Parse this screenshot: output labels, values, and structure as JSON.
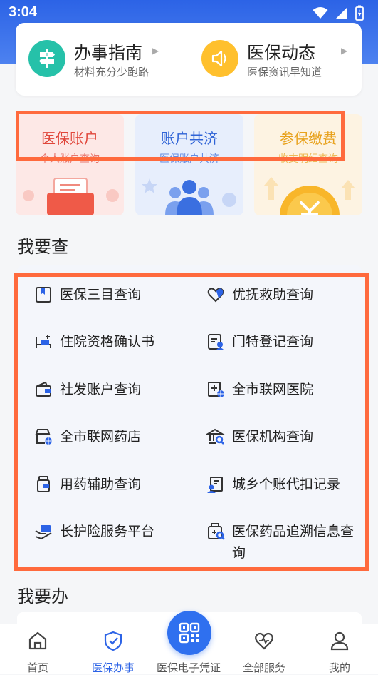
{
  "status": {
    "time": "3:04"
  },
  "guide": {
    "left": {
      "title": "办事指南",
      "subtitle": "材料充分少跑路",
      "icon": "signpost-icon"
    },
    "right": {
      "title": "医保动态",
      "subtitle": "医保资讯早知道",
      "icon": "speaker-icon"
    }
  },
  "tiles": [
    {
      "title": "医保账户",
      "subtitle": "个人账户查询",
      "color": "#e0463a",
      "bg": "#fde8e6"
    },
    {
      "title": "账户共济",
      "subtitle": "医保账户共济",
      "color": "#2f63d6",
      "bg": "#e7eefc"
    },
    {
      "title": "参保缴费",
      "subtitle": "收支明细查询",
      "color": "#e8a21d",
      "bg": "#fdf3e2"
    }
  ],
  "sections": {
    "query": "我要查",
    "handle": "我要办"
  },
  "query_items": [
    {
      "label": "医保三目查询",
      "icon": "bookmark-icon"
    },
    {
      "label": "优抚救助查询",
      "icon": "heart-hand-icon"
    },
    {
      "label": "住院资格确认书",
      "icon": "bed-icon"
    },
    {
      "label": "门特登记查询",
      "icon": "registration-icon"
    },
    {
      "label": "社发账户查询",
      "icon": "wallet-icon"
    },
    {
      "label": "全市联网医院",
      "icon": "hospital-network-icon"
    },
    {
      "label": "全市联网药店",
      "icon": "pharmacy-network-icon"
    },
    {
      "label": "医保机构查询",
      "icon": "institution-search-icon"
    },
    {
      "label": "用药辅助查询",
      "icon": "medicine-bottle-icon"
    },
    {
      "label": "城乡个账代扣记录",
      "icon": "account-deduct-icon"
    },
    {
      "label": "长护险服务平台",
      "icon": "care-hand-icon"
    },
    {
      "label": "医保药品追溯信息查询",
      "icon": "medicine-trace-icon"
    }
  ],
  "tabs": [
    {
      "label": "首页",
      "icon": "home-icon"
    },
    {
      "label": "医保办事",
      "icon": "shield-check-icon"
    },
    {
      "label": "医保电子凭证",
      "icon": "qr-code-icon"
    },
    {
      "label": "全部服务",
      "icon": "heart-pulse-icon"
    },
    {
      "label": "我的",
      "icon": "user-icon"
    }
  ],
  "colors": {
    "accent": "#2c63e6",
    "highlight": "#ff6a3d"
  }
}
